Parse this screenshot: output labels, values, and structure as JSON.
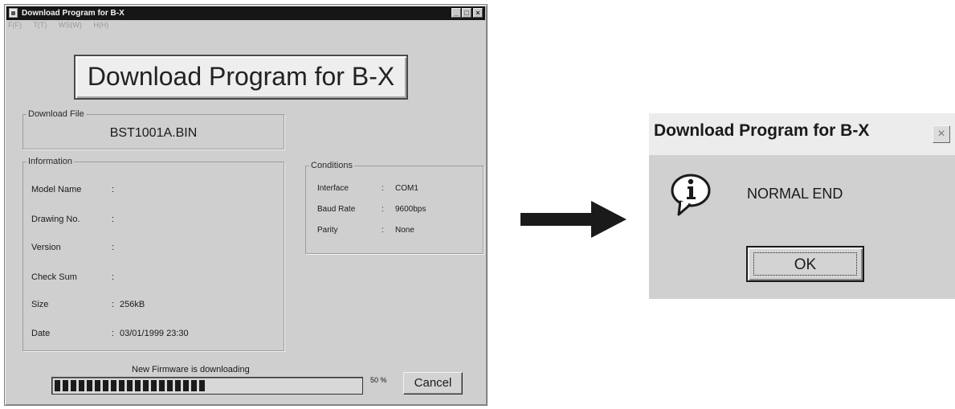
{
  "main_window": {
    "title": "Download Program for B-X",
    "title_buttons": [
      "_",
      "□",
      "×"
    ],
    "menu": [
      "F(F)",
      "T(T)",
      "WS(W)",
      "H(H)"
    ],
    "banner": "Download Program for B-X",
    "download_file": {
      "label": "Download File",
      "value": "BST1001A.BIN"
    },
    "information": {
      "label": "Information",
      "rows": [
        {
          "label": "Model Name",
          "colon": ":",
          "value": ""
        },
        {
          "label": "Drawing No.",
          "colon": ":",
          "value": ""
        },
        {
          "label": "Version",
          "colon": ":",
          "value": ""
        },
        {
          "label": "Check Sum",
          "colon": ":",
          "value": ""
        },
        {
          "label": "Size",
          "colon": ":",
          "value": "256kB"
        },
        {
          "label": "Date",
          "colon": ":",
          "value": "03/01/1999 23:30"
        }
      ]
    },
    "conditions": {
      "label": "Conditions",
      "rows": [
        {
          "label": "Interface",
          "colon": ":",
          "value": "COM1"
        },
        {
          "label": "Baud Rate",
          "colon": ":",
          "value": "9600bps"
        },
        {
          "label": "Parity",
          "colon": ":",
          "value": "None"
        }
      ]
    },
    "status_text": "New Firmware is downloading",
    "progress": {
      "fraction": 0.5,
      "label": "50 %"
    },
    "cancel_label": "Cancel"
  },
  "dialog": {
    "title": "Download Program for B-X",
    "close_symbol": "×",
    "icon": "information-icon",
    "message": "NORMAL END",
    "ok_label": "OK"
  },
  "arrow": {
    "icon": "right-arrow-icon"
  }
}
